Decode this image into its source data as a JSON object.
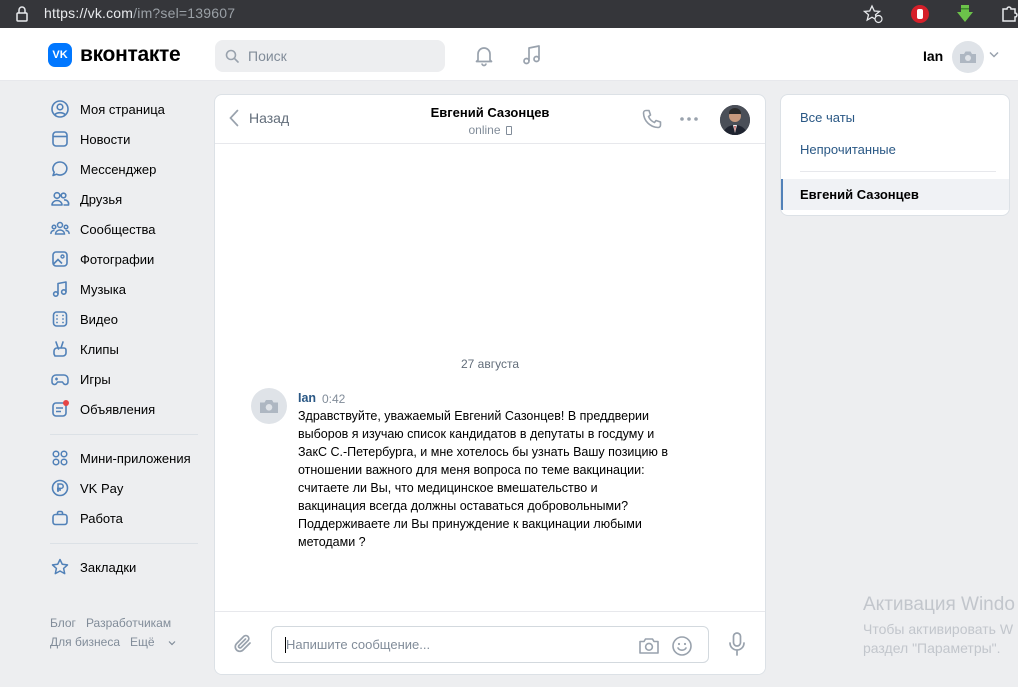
{
  "browser": {
    "url_main": "https://vk.com",
    "url_rest": "/im?sel=139607"
  },
  "header": {
    "logo_mark": "VK",
    "logo_text": "вконтакте",
    "search_placeholder": "Поиск",
    "user_name": "Ian"
  },
  "nav": {
    "items": [
      {
        "label": "Моя страница",
        "icon": "user-circle-icon"
      },
      {
        "label": "Новости",
        "icon": "newsfeed-icon"
      },
      {
        "label": "Мессенджер",
        "icon": "message-icon"
      },
      {
        "label": "Друзья",
        "icon": "friends-icon"
      },
      {
        "label": "Сообщества",
        "icon": "communities-icon"
      },
      {
        "label": "Фотографии",
        "icon": "photo-icon"
      },
      {
        "label": "Музыка",
        "icon": "music-icon"
      },
      {
        "label": "Видео",
        "icon": "video-icon"
      },
      {
        "label": "Клипы",
        "icon": "clips-icon"
      },
      {
        "label": "Игры",
        "icon": "gamepad-icon"
      },
      {
        "label": "Объявления",
        "icon": "ads-icon"
      },
      {
        "label": "Мини-приложения",
        "icon": "apps-icon"
      },
      {
        "label": "VK Pay",
        "icon": "vkpay-icon"
      },
      {
        "label": "Работа",
        "icon": "briefcase-icon"
      },
      {
        "label": "Закладки",
        "icon": "star-icon"
      }
    ],
    "footer": {
      "blog": "Блог",
      "developers": "Разработчикам",
      "business": "Для бизнеса",
      "more": "Ещё"
    }
  },
  "chat": {
    "back_label": "Назад",
    "peer_name": "Евгений Сазонцев",
    "peer_status": "online",
    "date_separator": "27 августа",
    "message": {
      "author": "Ian",
      "time": "0:42",
      "text": "Здравствуйте, уважаемый Евгений Сазонцев! В преддверии\nвыборов я изучаю список кандидатов в депутаты в госдуму и\nЗакС С.-Петербурга, и мне хотелось бы узнать Вашу позицию в\nотношении важного для меня вопроса по теме вакцинации:\nсчитаете ли Вы, что медицинское вмешательство и\nвакцинация всегда должны оставаться добровольными?\nПоддерживаете ли Вы принуждение к вакцинации любыми\nметодами ?"
    },
    "composer_placeholder": "Напишите сообщение..."
  },
  "right_panel": {
    "all_chats": "Все чаты",
    "unread": "Непрочитанные",
    "active_chat": "Евгений Сазонцев"
  },
  "watermark": {
    "title": "Активация Windo",
    "line1": "Чтобы активировать W",
    "line2": "раздел \"Параметры\"."
  },
  "colors": {
    "accent": "#0077ff",
    "link": "#2a5885",
    "icon": "#5181b8",
    "background": "#edeef0"
  }
}
